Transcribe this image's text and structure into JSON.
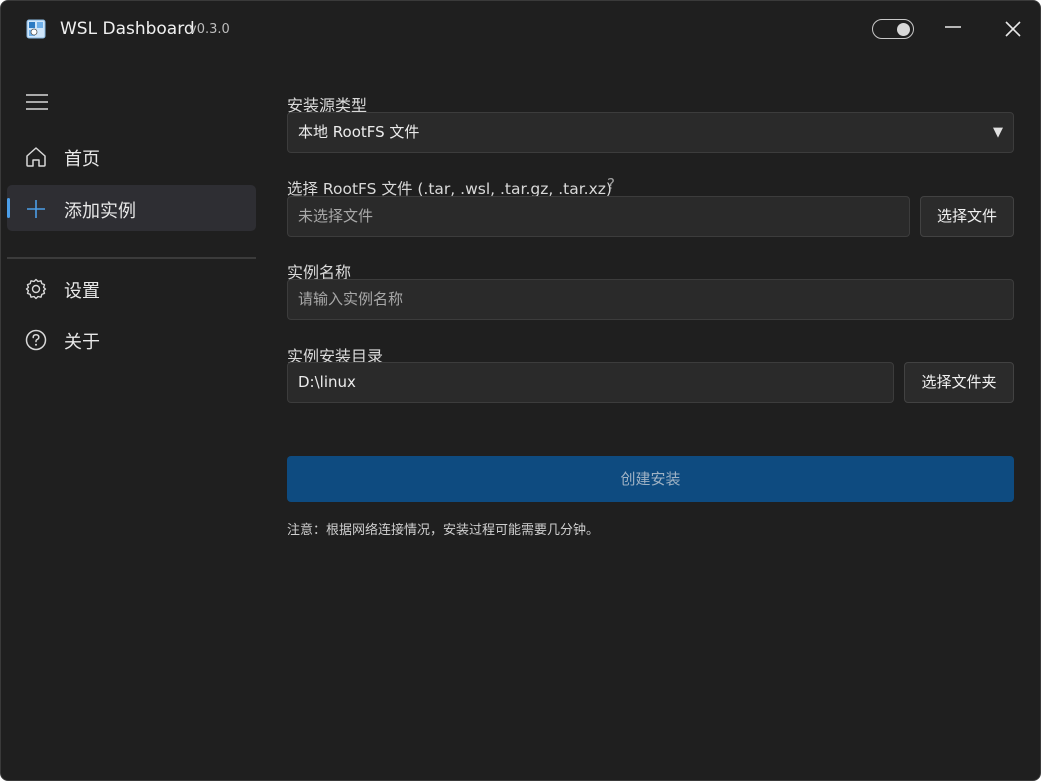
{
  "titlebar": {
    "app_name": "WSL Dashboard",
    "version": "v0.3.0",
    "icon": "app-window-icon",
    "theme_toggle_on": true,
    "minimize_icon": "minimize-icon",
    "close_icon": "close-icon"
  },
  "sidebar": {
    "menu_icon": "hamburger-menu-icon",
    "items": [
      {
        "label": "首页",
        "icon": "home-icon",
        "active": false
      },
      {
        "label": "添加实例",
        "icon": "plus-icon",
        "active": true
      },
      {
        "label": "设置",
        "icon": "gear-icon",
        "active": false
      },
      {
        "label": "关于",
        "icon": "question-circle-icon",
        "active": false
      }
    ]
  },
  "form": {
    "source_type": {
      "label": "安装源类型",
      "selected": "本地 RootFS 文件"
    },
    "rootfs_file": {
      "label": "选择 RootFS 文件 (.tar, .wsl, .tar.gz, .tar.xz)",
      "help": "?",
      "value": "未选择文件",
      "button": "选择文件"
    },
    "instance_name": {
      "label": "实例名称",
      "placeholder": "请输入实例名称"
    },
    "install_dir": {
      "label": "实例安装目录",
      "value": "D:\\linux",
      "button": "选择文件夹"
    },
    "submit": "创建安装",
    "note": "注意：根据网络连接情况，安装过程可能需要几分钟。"
  },
  "colors": {
    "background": "#1f1f1f",
    "accent": "#4c9ee8",
    "primary_button": "#0e4b80"
  }
}
